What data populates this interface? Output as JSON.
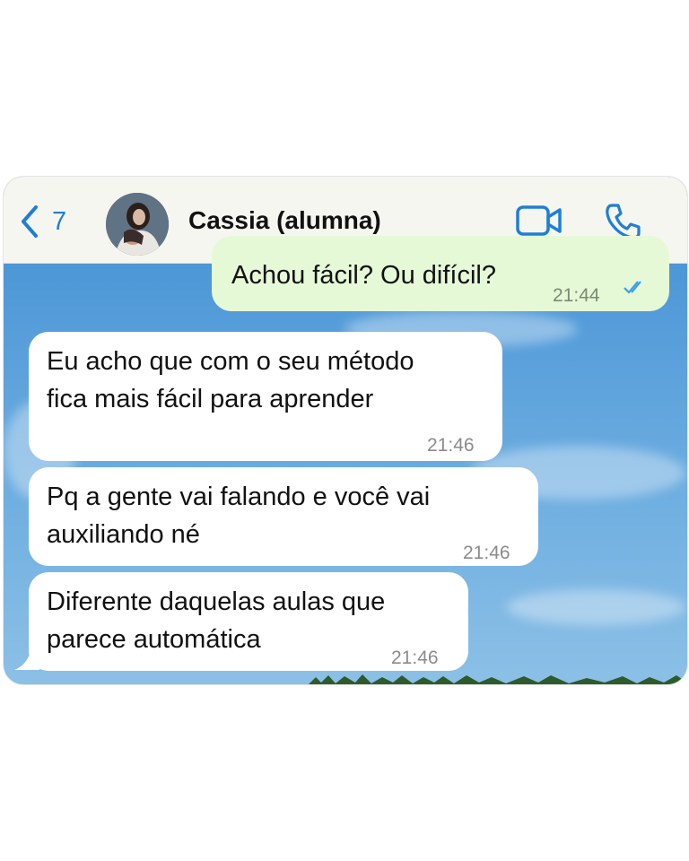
{
  "header": {
    "back_count": "7",
    "contact_name": "Cassia (alumna)"
  },
  "messages": [
    {
      "direction": "outgoing",
      "text": "Achou fácil? Ou difícil?",
      "time": "21:44",
      "status": "read"
    },
    {
      "direction": "incoming",
      "lines": [
        "Eu acho que com o seu método",
        "fica mais fácil para aprender"
      ],
      "time": "21:46"
    },
    {
      "direction": "incoming",
      "lines": [
        "Pq a gente vai falando e você vai",
        "auxiliando né"
      ],
      "time": "21:46"
    },
    {
      "direction": "incoming",
      "lines": [
        "Diferente daquelas aulas que",
        "parece automática"
      ],
      "time": "21:46"
    }
  ],
  "colors": {
    "accent": "#1f7ed6",
    "outgoing_bubble": "#e5f9d7",
    "incoming_bubble": "#ffffff",
    "read_ticks": "#3fa0e8"
  },
  "icons": [
    "chevron-left-icon",
    "video-camera-icon",
    "phone-icon",
    "double-check-icon"
  ]
}
